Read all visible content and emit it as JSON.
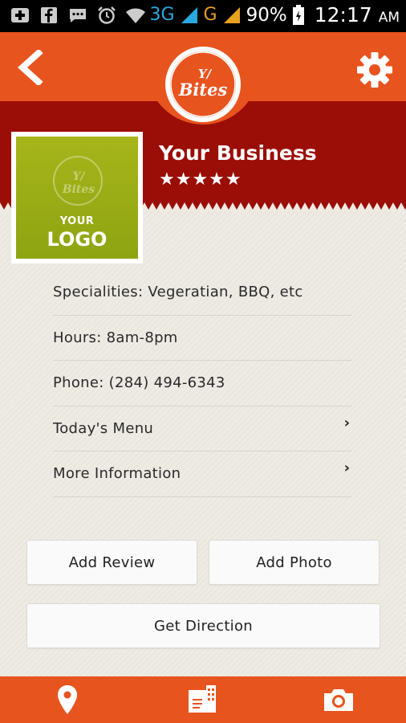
{
  "status_bar": {
    "network_3g": "3G",
    "network_g": "G",
    "battery": "90%",
    "time": "12:17",
    "time_suffix": "AM",
    "icons": [
      "plus-box-icon",
      "facebook-icon",
      "message-icon",
      "alarm-icon",
      "wifi-icon",
      "signal-icon",
      "battery-icon"
    ]
  },
  "header": {
    "app_logo": "Y/ Bites",
    "back_icon": "back-chevron-icon",
    "settings_icon": "gear-icon"
  },
  "business": {
    "name": "Your Business",
    "stars": "★★★★★",
    "rating": 5,
    "logo_top": "YOUR",
    "logo_bottom": "LOGO"
  },
  "info": {
    "specialities": "Specialities: Vegeratian, BBQ, etc",
    "hours": "Hours: 8am-8pm",
    "phone": "Phone: (284) 494-6343",
    "todays_menu": "Today's Menu",
    "more_info": "More Information"
  },
  "actions": {
    "add_review": "Add Review",
    "add_photo": "Add Photo",
    "get_direction": "Get Direction"
  },
  "bottom_nav": [
    "map-pin-icon",
    "menu-book-icon",
    "camera-icon"
  ],
  "colors": {
    "accent": "#e8541e",
    "header_red": "#9b0d07",
    "logo_green": "#9aad16",
    "background": "#eeeae4"
  }
}
